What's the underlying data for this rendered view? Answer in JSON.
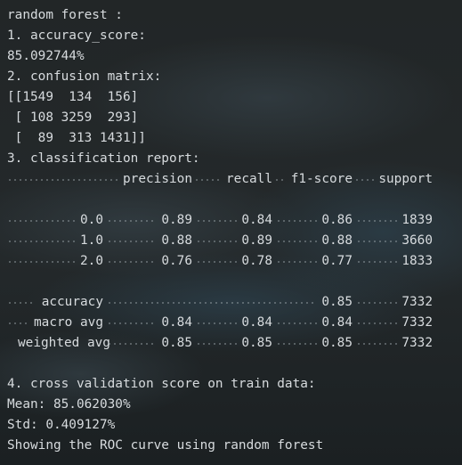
{
  "output": {
    "title": "random forest :",
    "section_accuracy_label": "1. accuracy_score:",
    "accuracy_value": "85.092744%",
    "section_confusion_label": "2. confusion matrix:",
    "confusion_rows": [
      "[[1549  134  156]",
      " [ 108 3259  293]",
      " [  89  313 1431]]"
    ],
    "section_report_label": "3. classification report:",
    "report": {
      "headers": [
        "precision",
        "recall",
        "f1-score",
        "support"
      ],
      "classes": [
        {
          "label": "0.0",
          "precision": "0.89",
          "recall": "0.84",
          "f1": "0.86",
          "support": "1839"
        },
        {
          "label": "1.0",
          "precision": "0.88",
          "recall": "0.89",
          "f1": "0.88",
          "support": "3660"
        },
        {
          "label": "2.0",
          "precision": "0.76",
          "recall": "0.78",
          "f1": "0.77",
          "support": "1833"
        }
      ],
      "accuracy": {
        "label": "accuracy",
        "f1": "0.85",
        "support": "7332"
      },
      "macro_avg": {
        "label": "macro avg",
        "precision": "0.84",
        "recall": "0.84",
        "f1": "0.84",
        "support": "7332"
      },
      "weighted_avg": {
        "label": "weighted avg",
        "precision": "0.85",
        "recall": "0.85",
        "f1": "0.85",
        "support": "7332"
      }
    },
    "section_cv_label": "4. cross validation score on train data:",
    "cv_mean": "Mean: 85.062030%",
    "cv_std": "Std: 0.409127%",
    "roc_message": "Showing the ROC curve using random forest"
  },
  "colors": {
    "background": "#1f2527",
    "text": "#d7dbde"
  }
}
